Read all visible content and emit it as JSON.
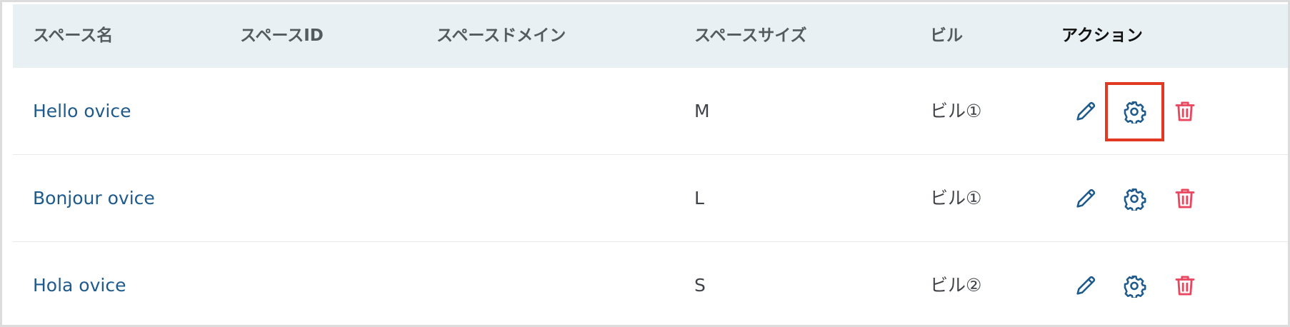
{
  "headers": {
    "space_name": "スペース名",
    "space_id": "スペースID",
    "space_domain": "スペースドメイン",
    "space_size": "スペースサイズ",
    "building": "ビル",
    "action": "アクション"
  },
  "rows": [
    {
      "name": "Hello ovice",
      "space_id": "",
      "domain": "",
      "size": "M",
      "building": "ビル①"
    },
    {
      "name": "Bonjour ovice",
      "space_id": "",
      "domain": "",
      "size": "L",
      "building": "ビル①"
    },
    {
      "name": "Hola ovice",
      "space_id": "",
      "domain": "",
      "size": "S",
      "building": "ビル②"
    }
  ],
  "icons": {
    "edit": "pencil-icon",
    "settings": "gear-icon",
    "delete": "trash-icon"
  },
  "colors": {
    "header_bg": "#e8f0f3",
    "link": "#1f5a8c",
    "icon_blue": "#1f5a8c",
    "delete_red": "#e8475f",
    "highlight": "#e23a22"
  },
  "highlighted": {
    "row": 0,
    "action": "settings"
  }
}
